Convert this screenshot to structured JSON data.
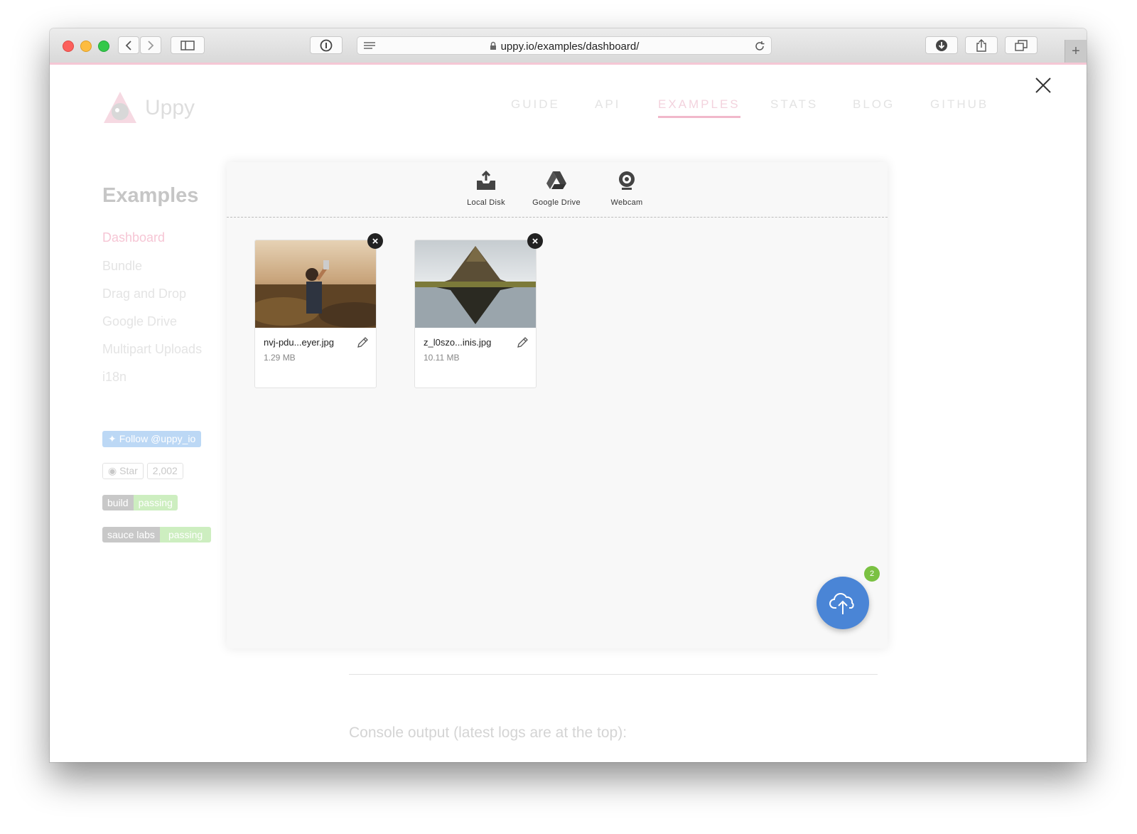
{
  "browser": {
    "url": "uppy.io/examples/dashboard/"
  },
  "site": {
    "logo_text": "Uppy",
    "nav": [
      {
        "label": "GUIDE"
      },
      {
        "label": "API"
      },
      {
        "label": "EXAMPLES"
      },
      {
        "label": "STATS"
      },
      {
        "label": "BLOG"
      },
      {
        "label": "GITHUB"
      }
    ],
    "sidebar": {
      "title": "Examples",
      "items": [
        {
          "label": "Dashboard"
        },
        {
          "label": "Bundle"
        },
        {
          "label": "Drag and Drop"
        },
        {
          "label": "Google Drive"
        },
        {
          "label": "Multipart Uploads"
        },
        {
          "label": "i18n"
        }
      ],
      "twitter_label": "Follow @uppy_io",
      "github_star_label": "Star",
      "github_star_count": "2,002",
      "build_badge": {
        "left": "build",
        "right": "passing"
      },
      "sauce_badge": {
        "left": "sauce labs",
        "right": "passing"
      }
    },
    "console_label": "Console output (latest logs are at the top):"
  },
  "dashboard": {
    "sources": [
      {
        "label": "Local Disk",
        "icon": "local-disk-icon"
      },
      {
        "label": "Google Drive",
        "icon": "google-drive-icon"
      },
      {
        "label": "Webcam",
        "icon": "webcam-icon"
      }
    ],
    "files": [
      {
        "name": "nvj-pdu...eyer.jpg",
        "size": "1.29 MB"
      },
      {
        "name": "z_l0szo...inis.jpg",
        "size": "10.11 MB"
      }
    ],
    "upload_count": "2"
  },
  "colors": {
    "upload_button": "#4a85d6",
    "count_badge": "#7ac142",
    "accent_pink": "#f1b8cb"
  }
}
